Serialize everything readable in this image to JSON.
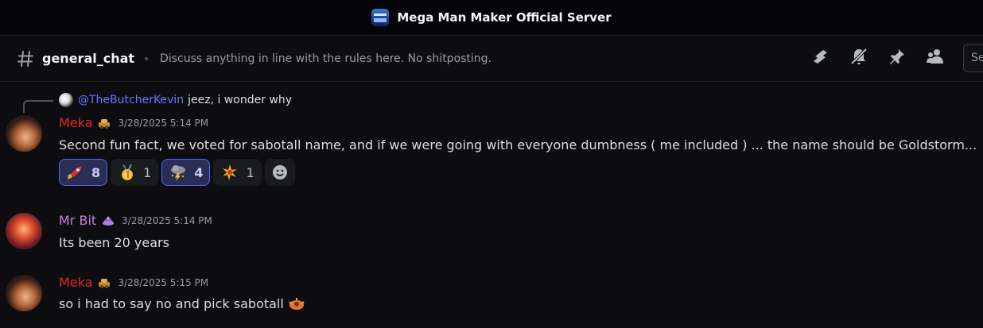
{
  "window": {
    "title": "Mega Man Maker Official Server"
  },
  "channel": {
    "name": "general_chat",
    "topic": "Discuss anything in line with the rules here. No shitposting.",
    "search_placeholder": "Se"
  },
  "header_icons": [
    "threads-icon",
    "mute-bell-icon",
    "pin-icon",
    "members-icon"
  ],
  "reply": {
    "username": "@TheButcherKevin",
    "text": "jeez, i wonder why"
  },
  "messages": [
    {
      "username": "Meka",
      "name_color": "#e3242b",
      "timestamp": "3/28/2025 5:14 PM",
      "text": "Second fun fact, we voted for sabotall name, and if we were going with everyone dumbness ( me included ) ... the name should be Goldstorm...",
      "reactions": [
        {
          "emoji": "rocket-icon",
          "count": "8",
          "active": true
        },
        {
          "emoji": "first-place-medal-icon",
          "count": "1",
          "active": false
        },
        {
          "emoji": "storm-cloud-icon",
          "count": "4",
          "active": true
        },
        {
          "emoji": "sparkle-burst-icon",
          "count": "1",
          "active": false
        }
      ]
    },
    {
      "username": "Mr Bit",
      "name_color": "#c27ee0",
      "timestamp": "3/28/2025 5:14 PM",
      "text": "Its been 20 years"
    },
    {
      "username": "Meka",
      "name_color": "#e3242b",
      "timestamp": "3/28/2025 5:15 PM",
      "text": "so i had to say no and pick sabotall"
    }
  ]
}
